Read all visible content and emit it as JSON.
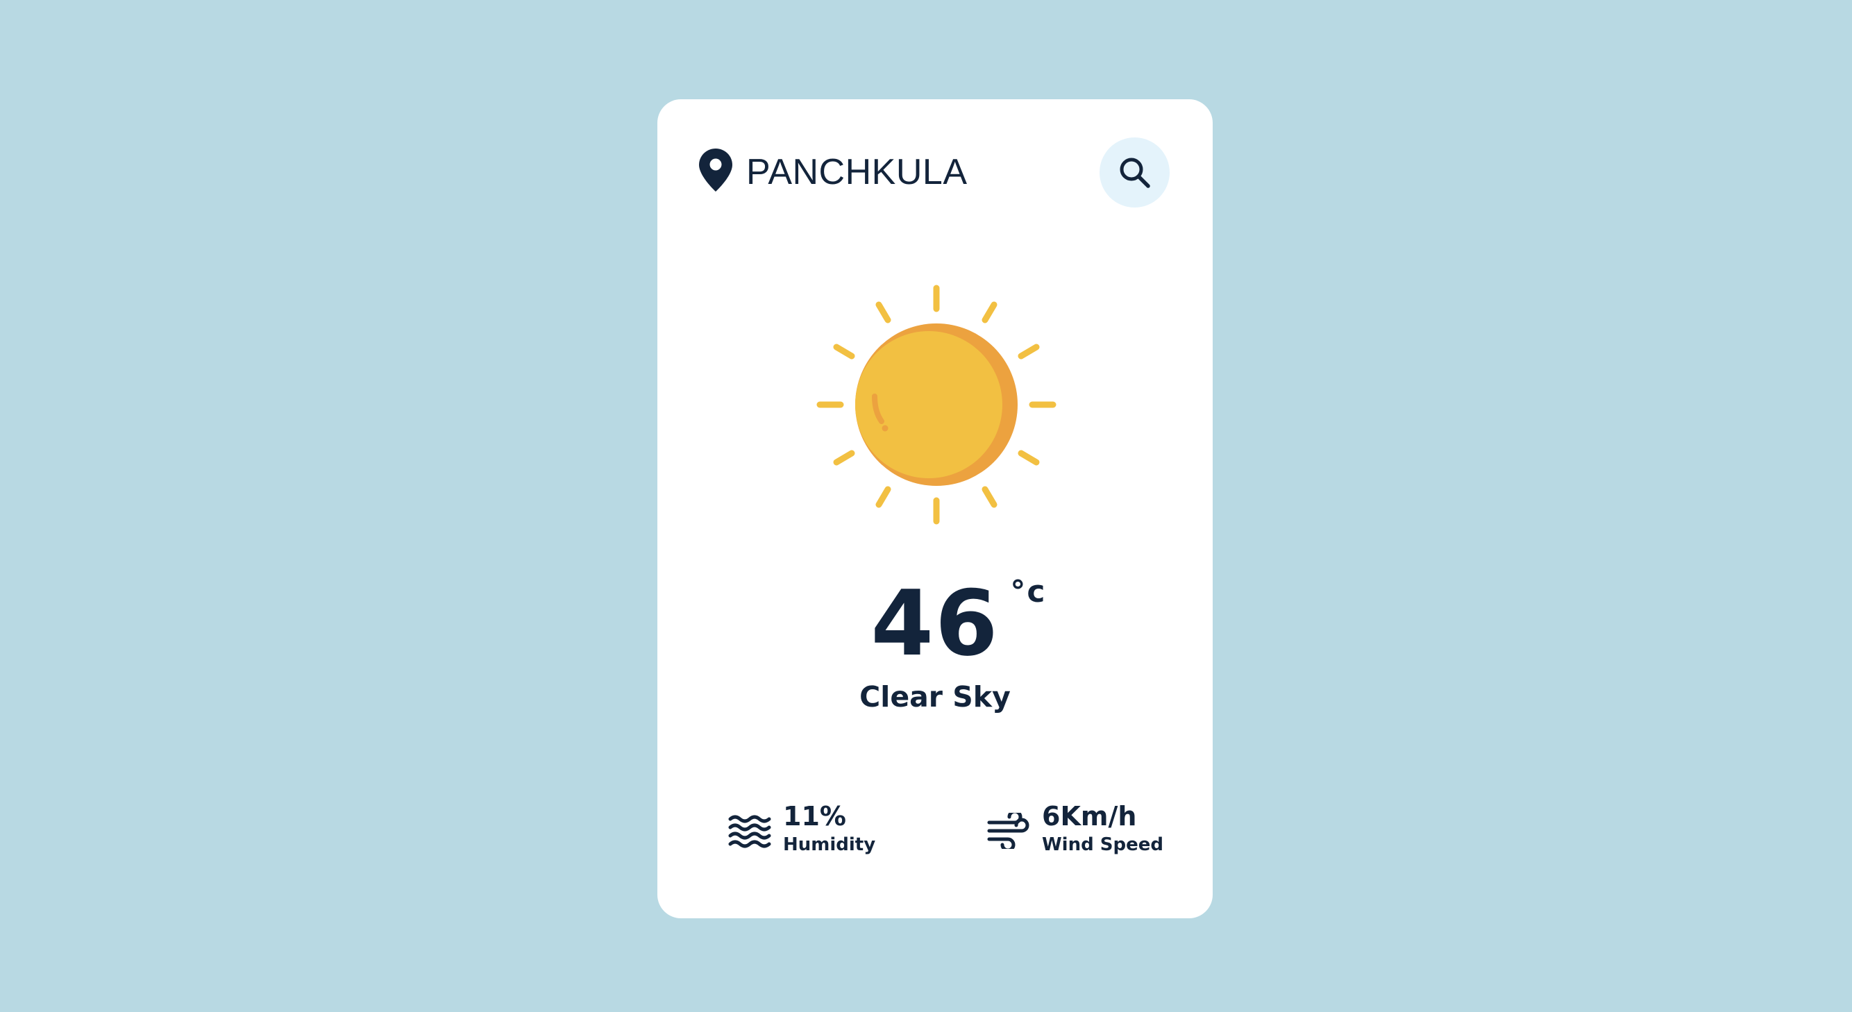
{
  "location": {
    "city": "PANCHKULA",
    "icon": "map-pin-icon"
  },
  "search": {
    "icon": "search-icon"
  },
  "weather": {
    "icon": "sun-icon",
    "temperature": "46",
    "unit": "°c",
    "condition": "Clear Sky"
  },
  "stats": {
    "humidity": {
      "icon": "waves-icon",
      "value": "11%",
      "label": "Humidity"
    },
    "wind": {
      "icon": "wind-icon",
      "value": "6Km/h",
      "label": "Wind Speed"
    }
  },
  "colors": {
    "background": "#b8d9e3",
    "card": "#ffffff",
    "text": "#13243b",
    "search_bg": "#e4f3fb",
    "sun": "#f2c042",
    "sun_shade": "#eca23f"
  }
}
